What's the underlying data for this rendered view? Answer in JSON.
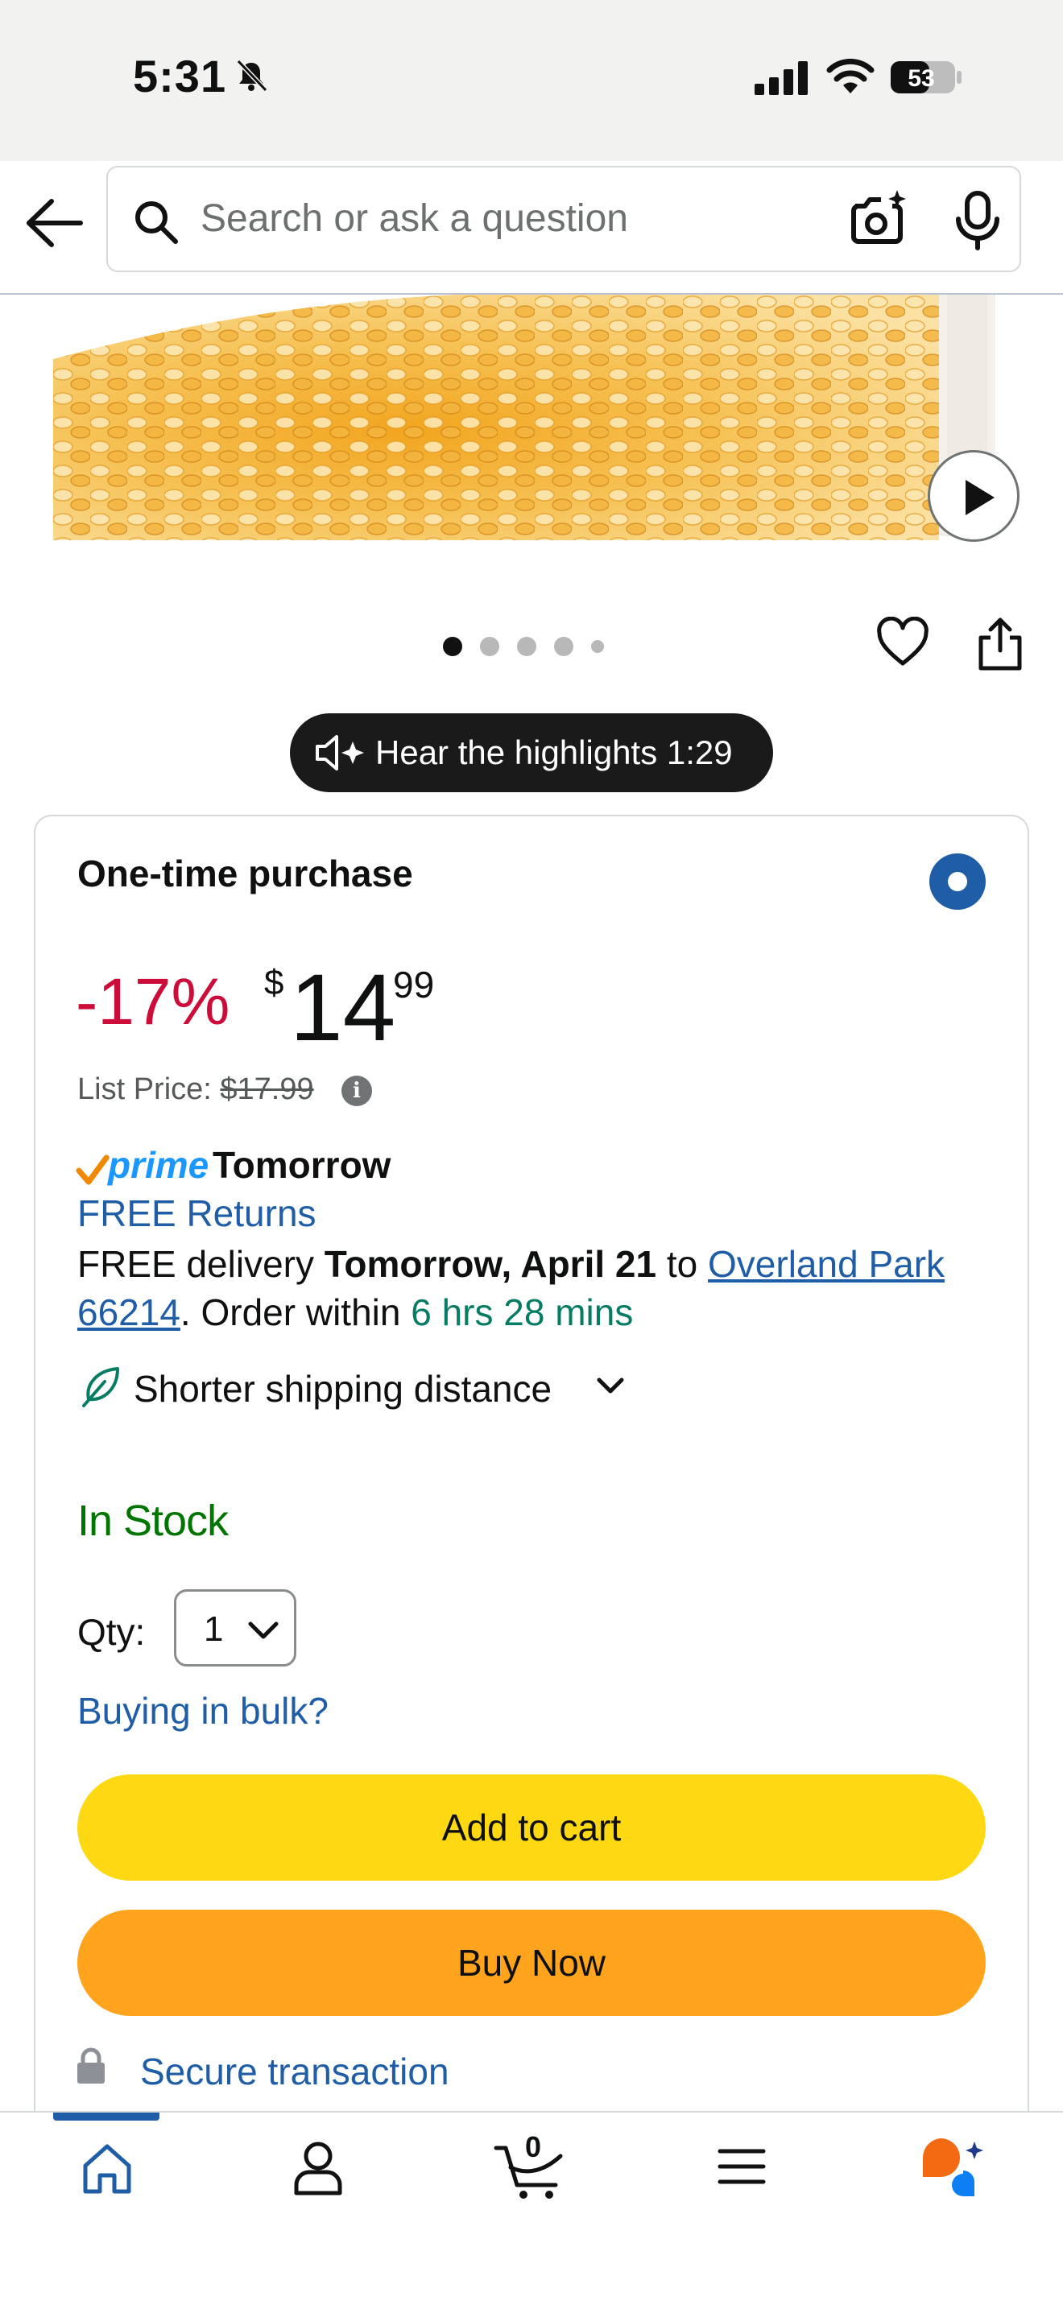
{
  "status_bar": {
    "time": "5:31",
    "battery": "53"
  },
  "search": {
    "placeholder": "Search or ask a question"
  },
  "product": {
    "image_count": 5,
    "active_image": 1
  },
  "audio": {
    "label": "Hear the highlights 1:29"
  },
  "buy_box": {
    "title": "One-time purchase",
    "discount": "-17%",
    "currency": "$",
    "price_whole": "14",
    "price_fraction": "99",
    "list_price_label": "List Price: ",
    "list_price_value": "$17.99",
    "info_glyph": "i",
    "prime_label": "prime",
    "prime_day": "Tomorrow",
    "free_returns": "FREE Returns",
    "delivery_prefix": "FREE delivery ",
    "delivery_date": "Tomorrow, April 21",
    "delivery_to": " to ",
    "delivery_location": "Overland Park 66214",
    "delivery_order_within": ". Order within ",
    "delivery_countdown": "6 hrs 28 mins",
    "shorter_shipping": "Shorter shipping distance",
    "stock_status": "In Stock",
    "qty_label": "Qty:",
    "qty_value": "1",
    "bulk_link": "Buying in bulk?",
    "add_to_cart": "Add to cart",
    "buy_now": "Buy Now",
    "secure": "Secure transaction"
  },
  "bottom_nav": {
    "cart_count": "0",
    "items": [
      "home",
      "account",
      "cart",
      "menu",
      "rufus"
    ]
  },
  "colors": {
    "discount_red": "#cc0c39",
    "link_blue": "#1f5ea6",
    "in_stock_green": "#007600",
    "countdown_green": "#067d62",
    "add_to_cart_yellow": "#ffd814",
    "buy_now_orange": "#ffa41c",
    "prime_blue": "#1a98ff"
  }
}
